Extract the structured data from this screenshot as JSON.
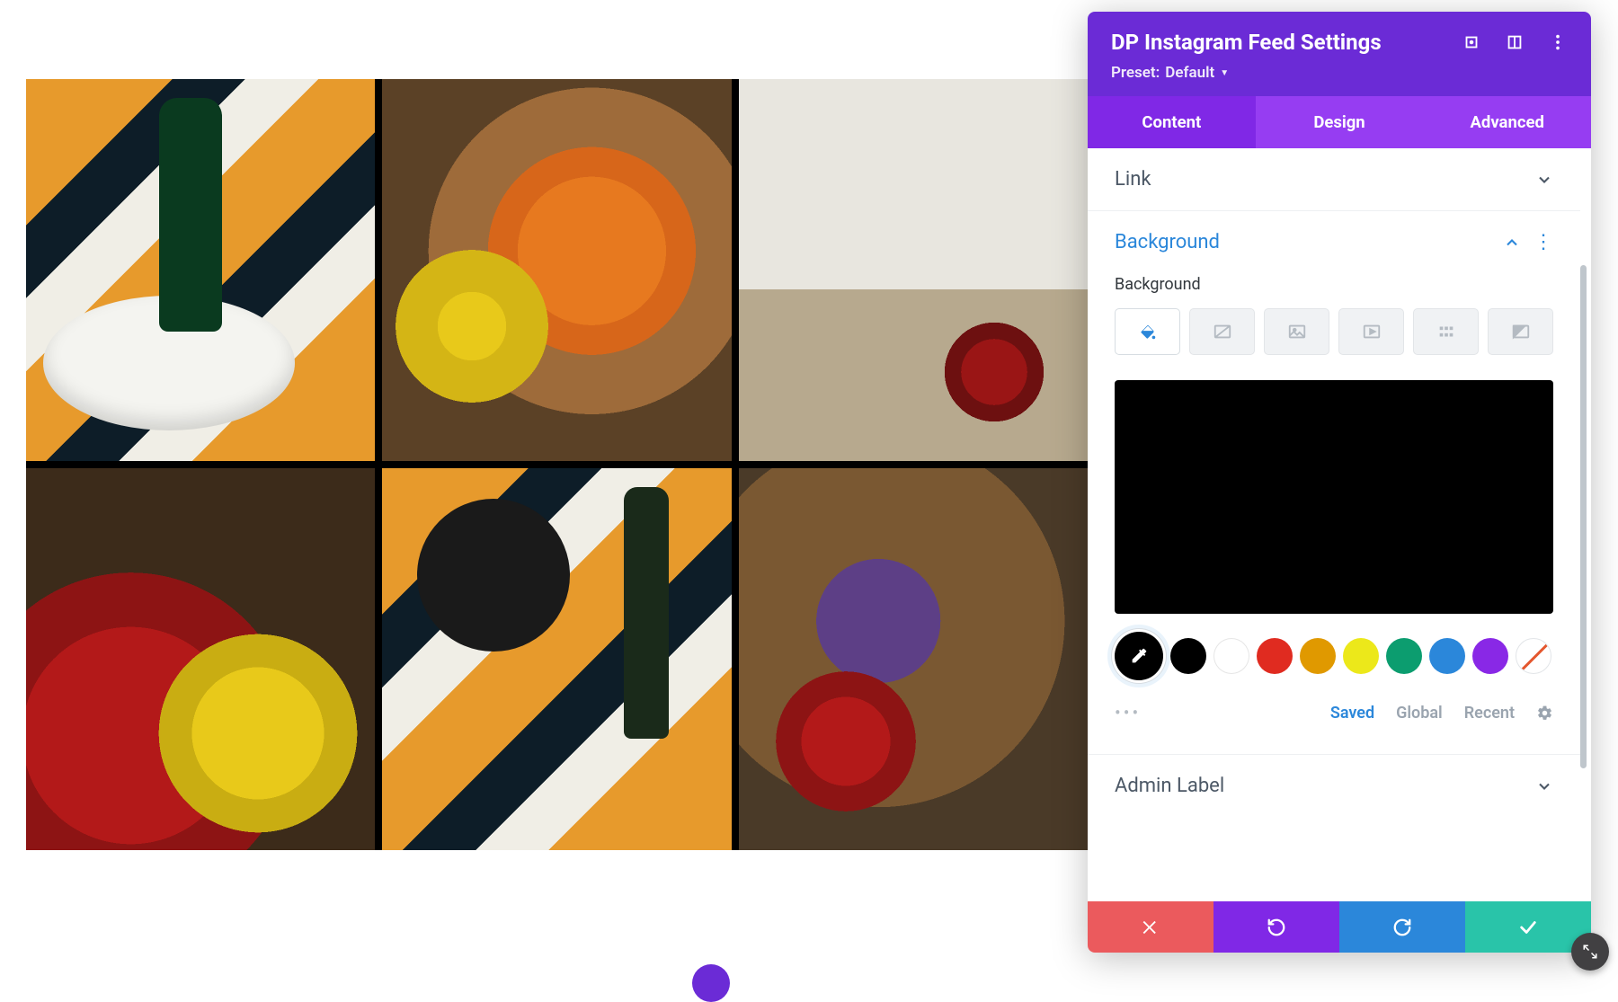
{
  "panel": {
    "title": "DP Instagram Feed Settings",
    "preset_prefix": "Preset:",
    "preset_value": "Default"
  },
  "tabs": {
    "content": "Content",
    "design": "Design",
    "advanced": "Advanced",
    "active": "content"
  },
  "sections": {
    "link": {
      "label": "Link"
    },
    "background": {
      "label": "Background",
      "sublabel": "Background",
      "preview_color": "#000000"
    },
    "admin_label": {
      "label": "Admin Label"
    }
  },
  "bg_types": [
    {
      "id": "color",
      "active": true
    },
    {
      "id": "gradient",
      "active": false
    },
    {
      "id": "image",
      "active": false
    },
    {
      "id": "video",
      "active": false
    },
    {
      "id": "pattern",
      "active": false
    },
    {
      "id": "mask",
      "active": false
    }
  ],
  "swatches": [
    {
      "id": "picker",
      "color": "#000000",
      "picker": true
    },
    {
      "id": "black",
      "color": "#000000"
    },
    {
      "id": "white",
      "color": "#ffffff",
      "white": true
    },
    {
      "id": "red",
      "color": "#e02b20"
    },
    {
      "id": "orange",
      "color": "#edb059"
    },
    {
      "id": "yellow",
      "color": "#ece81a"
    },
    {
      "id": "green",
      "color": "#0c9d6f"
    },
    {
      "id": "blue",
      "color": "#2b87da"
    },
    {
      "id": "purple",
      "color": "#8928e6"
    },
    {
      "id": "none",
      "color": "none",
      "none": true
    }
  ],
  "palette_tabs": {
    "saved": "Saved",
    "global": "Global",
    "recent": "Recent",
    "active": "saved"
  }
}
